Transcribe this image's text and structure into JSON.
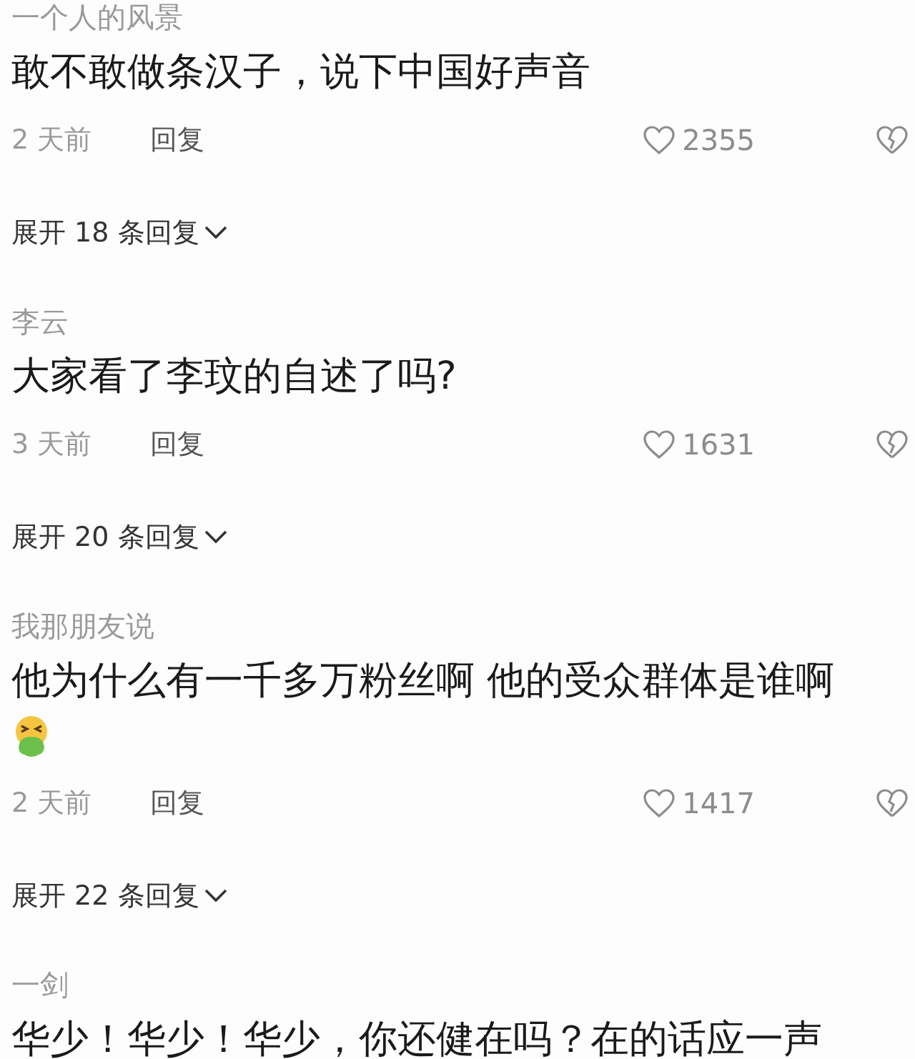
{
  "comments": [
    {
      "username": "一个人的风景",
      "text": "敢不敢做条汉子，说下中国好声音",
      "emoji": false,
      "time": "2 天前",
      "reply": "回复",
      "likes": "2355",
      "expand": "展开 18 条回复"
    },
    {
      "username": "李云",
      "text": "大家看了李玟的自述了吗?",
      "emoji": false,
      "time": "3 天前",
      "reply": "回复",
      "likes": "1631",
      "expand": "展开 20 条回复"
    },
    {
      "username": "我那朋友说",
      "text": "他为什么有一千多万粉丝啊 他的受众群体是谁啊",
      "emoji": true,
      "time": "2 天前",
      "reply": "回复",
      "likes": "1417",
      "expand": "展开 22 条回复"
    },
    {
      "username": "一剑",
      "text": "华少！华少！华少，你还健在吗？在的话应一声"
    }
  ]
}
